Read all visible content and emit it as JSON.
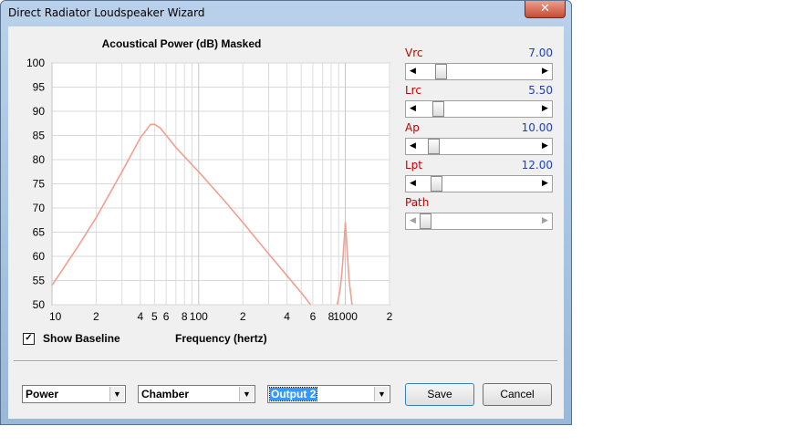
{
  "window": {
    "title": "Direct Radiator Loudspeaker Wizard",
    "close_label": "✕"
  },
  "chart": {
    "title": "Acoustical Power (dB)   Masked",
    "xlabel": "Frequency (hertz)",
    "x_tick_labels": [
      "10",
      "2",
      "4",
      "5",
      "6",
      "8",
      "100",
      "2",
      "4",
      "6",
      "8",
      "1000",
      "2"
    ],
    "y_tick_labels": [
      "100",
      "95",
      "90",
      "85",
      "80",
      "75",
      "70",
      "65",
      "60",
      "55",
      "50"
    ]
  },
  "chart_data": {
    "type": "line",
    "title": "Acoustical Power (dB)   Masked",
    "xlabel": "Frequency (hertz)",
    "ylabel": "",
    "xscale": "log",
    "xlim": [
      10,
      2000
    ],
    "ylim": [
      50,
      100
    ],
    "grid": true,
    "color": "#f0a090",
    "series": [
      {
        "points": [
          [
            10,
            54
          ],
          [
            15,
            62
          ],
          [
            20,
            68
          ],
          [
            30,
            77.5
          ],
          [
            40,
            84.5
          ],
          [
            47,
            87.3
          ],
          [
            50,
            87.3
          ],
          [
            55,
            86.5
          ],
          [
            70,
            82.5
          ],
          [
            100,
            77.5
          ],
          [
            150,
            71.5
          ],
          [
            200,
            67
          ],
          [
            300,
            60.5
          ],
          [
            400,
            56
          ],
          [
            500,
            52.5
          ],
          [
            580,
            50
          ]
        ]
      },
      {
        "points": [
          [
            880,
            50
          ],
          [
            920,
            53
          ],
          [
            950,
            57
          ],
          [
            980,
            63
          ],
          [
            1000,
            67
          ],
          [
            1020,
            63
          ],
          [
            1060,
            55
          ],
          [
            1110,
            50
          ]
        ]
      }
    ]
  },
  "controls": {
    "vrc": {
      "label": "Vrc",
      "value": "7.00",
      "position": 0.15
    },
    "lrc": {
      "label": "Lrc",
      "value": "5.50",
      "position": 0.12
    },
    "ap": {
      "label": "Ap",
      "value": "10.00",
      "position": 0.08
    },
    "lpt": {
      "label": "Lpt",
      "value": "12.00",
      "position": 0.1
    },
    "path": {
      "label": "Path",
      "value": "",
      "position": 0.0
    }
  },
  "show_baseline": {
    "label": "Show Baseline",
    "checked_glyph": "✓"
  },
  "dropdowns": {
    "mode": "Power",
    "placement": "Chamber",
    "output": "Output 2",
    "arrow_glyph": "▼"
  },
  "buttons": {
    "save": "Save",
    "cancel": "Cancel"
  }
}
